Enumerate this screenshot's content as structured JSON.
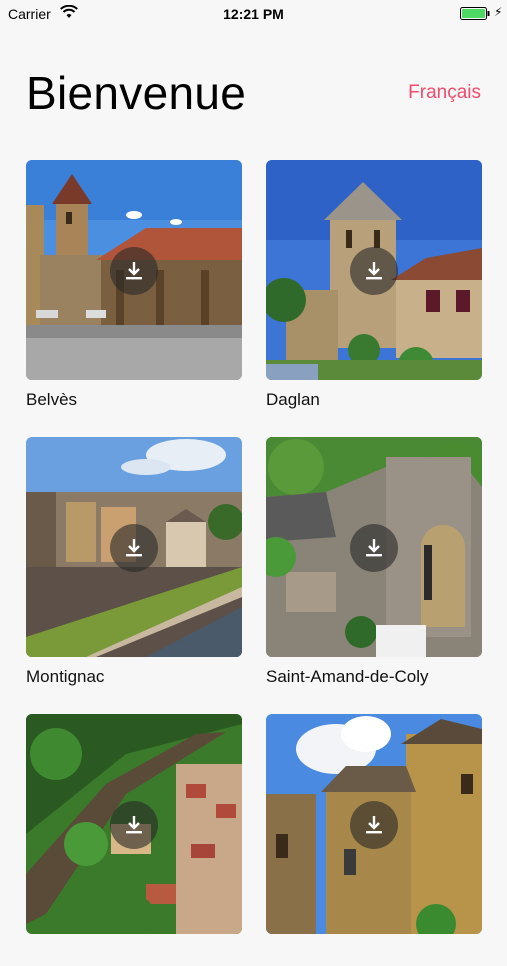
{
  "status_bar": {
    "carrier": "Carrier",
    "time": "12:21 PM",
    "battery_color": "#4cd964"
  },
  "header": {
    "title": "Bienvenue",
    "language_label": "Français",
    "accent_color": "#f14b6e"
  },
  "villages": [
    {
      "name": "Belvès",
      "icon": "download-icon"
    },
    {
      "name": "Daglan",
      "icon": "download-icon"
    },
    {
      "name": "Montignac",
      "icon": "download-icon"
    },
    {
      "name": "Saint-Amand-de-Coly",
      "icon": "download-icon"
    },
    {
      "name": "",
      "icon": "download-icon"
    },
    {
      "name": "",
      "icon": "download-icon"
    }
  ]
}
